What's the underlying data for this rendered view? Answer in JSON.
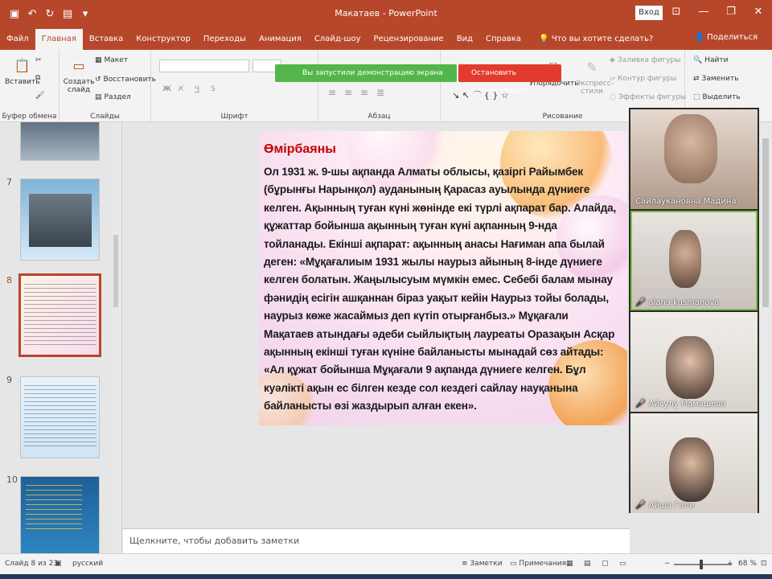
{
  "app": {
    "window_title": "Макатаев - PowerPoint",
    "sign_in": "Вход"
  },
  "tabs": [
    {
      "label": "Файл"
    },
    {
      "label": "Главная",
      "active": true
    },
    {
      "label": "Вставка"
    },
    {
      "label": "Конструктор"
    },
    {
      "label": "Переходы"
    },
    {
      "label": "Анимация"
    },
    {
      "label": "Слайд-шоу"
    },
    {
      "label": "Рецензирование"
    },
    {
      "label": "Вид"
    },
    {
      "label": "Справка"
    }
  ],
  "tell_me": "Что вы хотите сделать?",
  "share": "Поделиться",
  "ribbon": {
    "clipboard": {
      "paste": "Вставить",
      "label": "Буфер обмена"
    },
    "slides": {
      "new_slide": "Создать слайд",
      "layout": "Макет",
      "reset": "Восстановить",
      "section": "Раздел",
      "label": "Слайды"
    },
    "font": {
      "label": "Шрифт",
      "bold": "Ж",
      "italic": "К",
      "underline": "Ч",
      "strike": "S"
    },
    "paragraph": {
      "label": "Абзац"
    },
    "drawing": {
      "label": "Рисование",
      "arrange": "Упорядочить",
      "quick_styles": "Экспресс-стили",
      "fill": "Заливка фигуры",
      "outline": "Контур фигуры",
      "effects": "Эффекты фигуры"
    },
    "editing": {
      "find": "Найти",
      "replace": "Заменить",
      "select": "Выделить"
    }
  },
  "screen_share": {
    "notice": "Вы запустили демонстрацию экрана",
    "stop": "Остановить демонстрацию"
  },
  "thumbnails": [
    {
      "number": "7"
    },
    {
      "number": "8",
      "selected": true
    },
    {
      "number": "9"
    },
    {
      "number": "10"
    }
  ],
  "slide": {
    "title": "Өмірбаяны",
    "lines": [
      "Ол 1931 ж. 9-шы ақпанда Алматы облысы, қазіргі Райымбек",
      "(бұрынғы Нарынқол) ауданының Қарасаз ауылында дүниеге",
      "келген. Ақынның туған күні жөнінде екі түрлі ақпарат бар. Алайда,",
      "құжаттар бойынша ақынның туған күні ақпанның 9-нда",
      "тойланады. Екінші ақпарат: ақынның анасы Нағиман апа былай",
      "деген: «Мұқағалиым 1931 жылы наурыз айының 8-інде дүниеге",
      "келген болатын. Жаңылысуым мүмкін емес. Себебі балам мынау",
      "фәнидің есігін ашқаннан біраз уақыт кейін Наурыз тойы болады,",
      "наурыз көже жасаймыз деп күтіп отырғанбыз.» Мұқағали",
      "Мақатаев атындағы әдеби сыйлықтың лауреаты Оразақын Асқар",
      "ақынның екінші туған күніне байланысты мынадай сөз айтады:",
      "«Ал құжат бойынша Мұқағали 9 ақпанда дүниеге келген. Бұл",
      "куәлікті ақын ес білген кезде сол кездегі сайлау науқанына",
      "байланысты өзі жаздырып алған екен»."
    ]
  },
  "notes_placeholder": "Щелкните, чтобы добавить заметки",
  "participants": [
    {
      "name": "Сайлаукановна Мадина",
      "muted": false
    },
    {
      "name": "alana kusmanova",
      "muted": true
    },
    {
      "name": "Айсулу Мамашева",
      "muted": true
    },
    {
      "name": "Айша Гали",
      "muted": true
    }
  ],
  "status": {
    "slide_info": "Слайд 8 из 23",
    "language": "русский",
    "notes": "Заметки",
    "comments": "Примечания",
    "zoom": "68 %"
  },
  "colors": {
    "accent": "#b7472a",
    "slide_title": "#c00000",
    "share_green": "#53b64a",
    "share_red": "#e23b2e"
  }
}
